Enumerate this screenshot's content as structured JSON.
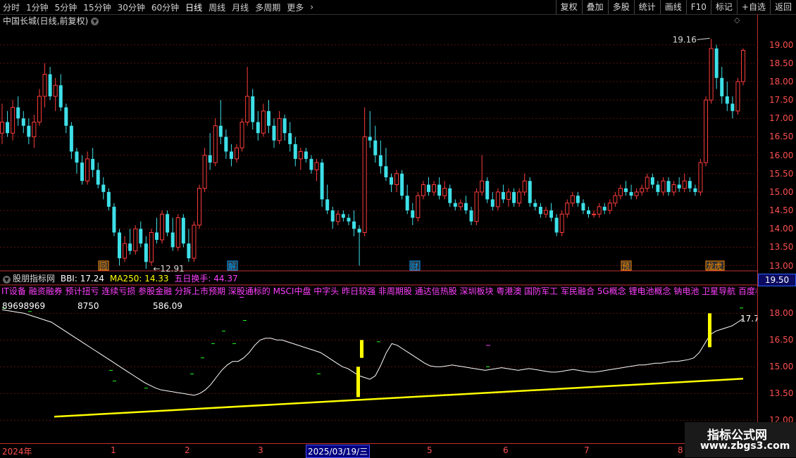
{
  "toolbar": {
    "periods": [
      "分时",
      "1分钟",
      "5分钟",
      "15分钟",
      "30分钟",
      "60分钟",
      "日线",
      "周线",
      "月线",
      "多周期",
      "更多"
    ],
    "active_period": "日线",
    "more_arrow": "›",
    "actions": [
      "复权",
      "叠加",
      "多股",
      "统计",
      "画线",
      "F10",
      "标记",
      "+自选",
      "返回"
    ]
  },
  "stock": {
    "title": "中国长城(日线,前复权)",
    "dropdown_icon": "chevron-down-icon"
  },
  "main_chart": {
    "y_ticks": [
      "19.00",
      "18.50",
      "18.00",
      "17.50",
      "17.00",
      "16.50",
      "16.00",
      "15.50",
      "15.00",
      "14.50",
      "14.00",
      "13.50",
      "13.00"
    ],
    "high_label": "19.16",
    "low_label": "12.91",
    "markers": [
      "回",
      "解",
      "财",
      "预",
      "龙虎"
    ]
  },
  "sub_chart": {
    "indicator_name": "股朋指标网",
    "bbi": "BBI: 17.24",
    "ma250": "MA250: 14.33",
    "turnover": "五日换手: 44.37",
    "concepts": "IT设备 融资融券 预计扭亏 连续亏损 参股金融 分拆上市预期 深股通标的 MSCI中盘 中字头 昨日较强 非周期股 通达信热股 深圳板块 粤港澳 国防军工 军民融合 5G概念 锂电池概念 钠电池 卫星导航 百度概念",
    "num1": "89698969",
    "num2": "8750",
    "num3": "586.09",
    "last_value": "17.7",
    "price_box": "19.50",
    "y_ticks": [
      "18.00",
      "16.50",
      "15.00",
      "13.50",
      "12.00"
    ]
  },
  "x_axis": {
    "labels": [
      "2024年",
      "1",
      "2",
      "3",
      "5",
      "6",
      "7",
      "8"
    ],
    "selected": "2025/03/19/三"
  },
  "watermark": {
    "line1": "指标公式网",
    "line2": "www.zbgs3.com"
  },
  "colors": {
    "up": "#ff3c3c",
    "down": "#3ee0e8",
    "bbi_line": "#ffffff",
    "ma_line": "#ffff00",
    "axis": "#ff5050"
  },
  "chart_data": {
    "type": "candlestick",
    "ylim": [
      12.8,
      19.3
    ],
    "candles": [
      {
        "o": 16.6,
        "h": 17.4,
        "l": 16.3,
        "c": 16.9
      },
      {
        "o": 16.9,
        "h": 17.2,
        "l": 16.5,
        "c": 16.6
      },
      {
        "o": 16.6,
        "h": 17.5,
        "l": 16.4,
        "c": 17.3
      },
      {
        "o": 17.3,
        "h": 17.6,
        "l": 16.8,
        "c": 17.0
      },
      {
        "o": 17.0,
        "h": 17.2,
        "l": 16.6,
        "c": 16.8
      },
      {
        "o": 16.8,
        "h": 17.0,
        "l": 16.3,
        "c": 16.5
      },
      {
        "o": 16.5,
        "h": 17.1,
        "l": 16.2,
        "c": 16.9
      },
      {
        "o": 16.9,
        "h": 17.8,
        "l": 16.8,
        "c": 17.6
      },
      {
        "o": 17.6,
        "h": 18.5,
        "l": 17.3,
        "c": 18.2
      },
      {
        "o": 18.2,
        "h": 18.4,
        "l": 17.5,
        "c": 17.6
      },
      {
        "o": 17.6,
        "h": 18.1,
        "l": 17.2,
        "c": 17.9
      },
      {
        "o": 17.9,
        "h": 18.2,
        "l": 17.2,
        "c": 17.3
      },
      {
        "o": 17.3,
        "h": 17.4,
        "l": 16.6,
        "c": 16.8
      },
      {
        "o": 16.8,
        "h": 16.9,
        "l": 15.9,
        "c": 16.1
      },
      {
        "o": 16.1,
        "h": 16.2,
        "l": 15.5,
        "c": 15.8
      },
      {
        "o": 15.8,
        "h": 16.0,
        "l": 15.2,
        "c": 15.3
      },
      {
        "o": 15.3,
        "h": 16.1,
        "l": 15.2,
        "c": 15.9
      },
      {
        "o": 15.9,
        "h": 16.2,
        "l": 15.4,
        "c": 15.6
      },
      {
        "o": 15.6,
        "h": 15.8,
        "l": 15.1,
        "c": 15.2
      },
      {
        "o": 15.2,
        "h": 15.4,
        "l": 14.8,
        "c": 15.0
      },
      {
        "o": 15.0,
        "h": 15.1,
        "l": 14.5,
        "c": 14.6
      },
      {
        "o": 14.6,
        "h": 14.7,
        "l": 13.8,
        "c": 13.9
      },
      {
        "o": 13.9,
        "h": 14.0,
        "l": 13.0,
        "c": 13.2
      },
      {
        "o": 13.2,
        "h": 13.8,
        "l": 13.1,
        "c": 13.6
      },
      {
        "o": 13.6,
        "h": 14.0,
        "l": 13.3,
        "c": 13.4
      },
      {
        "o": 13.4,
        "h": 14.1,
        "l": 13.3,
        "c": 14.0
      },
      {
        "o": 14.0,
        "h": 14.2,
        "l": 13.5,
        "c": 13.6
      },
      {
        "o": 13.6,
        "h": 13.8,
        "l": 12.91,
        "c": 13.1
      },
      {
        "o": 13.1,
        "h": 14.0,
        "l": 13.0,
        "c": 13.9
      },
      {
        "o": 13.9,
        "h": 14.3,
        "l": 13.6,
        "c": 13.7
      },
      {
        "o": 13.7,
        "h": 14.5,
        "l": 13.6,
        "c": 14.4
      },
      {
        "o": 14.4,
        "h": 14.5,
        "l": 13.8,
        "c": 13.9
      },
      {
        "o": 13.9,
        "h": 14.3,
        "l": 13.4,
        "c": 13.5
      },
      {
        "o": 13.5,
        "h": 14.4,
        "l": 13.4,
        "c": 14.3
      },
      {
        "o": 14.3,
        "h": 14.4,
        "l": 13.5,
        "c": 13.6
      },
      {
        "o": 13.6,
        "h": 14.0,
        "l": 13.1,
        "c": 13.2
      },
      {
        "o": 13.2,
        "h": 14.2,
        "l": 13.1,
        "c": 14.1
      },
      {
        "o": 14.1,
        "h": 15.2,
        "l": 14.0,
        "c": 15.1
      },
      {
        "o": 15.1,
        "h": 16.2,
        "l": 15.0,
        "c": 16.0
      },
      {
        "o": 16.0,
        "h": 16.6,
        "l": 15.6,
        "c": 15.8
      },
      {
        "o": 15.8,
        "h": 17.0,
        "l": 15.7,
        "c": 16.8
      },
      {
        "o": 16.8,
        "h": 17.5,
        "l": 16.3,
        "c": 16.5
      },
      {
        "o": 16.5,
        "h": 16.7,
        "l": 15.9,
        "c": 16.1
      },
      {
        "o": 16.1,
        "h": 16.3,
        "l": 15.7,
        "c": 15.9
      },
      {
        "o": 15.9,
        "h": 16.3,
        "l": 15.8,
        "c": 16.2
      },
      {
        "o": 16.2,
        "h": 17.0,
        "l": 16.1,
        "c": 16.9
      },
      {
        "o": 16.9,
        "h": 18.4,
        "l": 16.8,
        "c": 17.6
      },
      {
        "o": 17.6,
        "h": 17.8,
        "l": 16.7,
        "c": 16.9
      },
      {
        "o": 16.9,
        "h": 17.2,
        "l": 16.4,
        "c": 16.6
      },
      {
        "o": 16.6,
        "h": 17.4,
        "l": 16.5,
        "c": 17.2
      },
      {
        "o": 17.2,
        "h": 17.5,
        "l": 16.6,
        "c": 16.8
      },
      {
        "o": 16.8,
        "h": 17.0,
        "l": 16.2,
        "c": 16.4
      },
      {
        "o": 16.4,
        "h": 17.2,
        "l": 16.3,
        "c": 17.0
      },
      {
        "o": 17.0,
        "h": 17.1,
        "l": 16.4,
        "c": 16.6
      },
      {
        "o": 16.6,
        "h": 16.9,
        "l": 16.1,
        "c": 16.3
      },
      {
        "o": 16.3,
        "h": 16.5,
        "l": 15.7,
        "c": 15.9
      },
      {
        "o": 15.9,
        "h": 16.2,
        "l": 15.6,
        "c": 16.1
      },
      {
        "o": 16.1,
        "h": 16.2,
        "l": 15.8,
        "c": 15.9
      },
      {
        "o": 15.9,
        "h": 16.0,
        "l": 15.5,
        "c": 15.6
      },
      {
        "o": 15.6,
        "h": 15.9,
        "l": 15.3,
        "c": 15.8
      },
      {
        "o": 15.8,
        "h": 15.9,
        "l": 14.6,
        "c": 14.8
      },
      {
        "o": 14.8,
        "h": 15.2,
        "l": 14.4,
        "c": 14.5
      },
      {
        "o": 14.5,
        "h": 14.6,
        "l": 14.0,
        "c": 14.2
      },
      {
        "o": 14.2,
        "h": 14.5,
        "l": 14.1,
        "c": 14.4
      },
      {
        "o": 14.4,
        "h": 14.5,
        "l": 14.2,
        "c": 14.3
      },
      {
        "o": 14.3,
        "h": 14.4,
        "l": 14.1,
        "c": 14.2
      },
      {
        "o": 14.2,
        "h": 14.5,
        "l": 13.8,
        "c": 14.0
      },
      {
        "o": 14.0,
        "h": 14.1,
        "l": 13.0,
        "c": 13.9
      },
      {
        "o": 13.9,
        "h": 17.3,
        "l": 13.8,
        "c": 16.5
      },
      {
        "o": 16.5,
        "h": 17.2,
        "l": 16.2,
        "c": 16.4
      },
      {
        "o": 16.4,
        "h": 16.8,
        "l": 15.8,
        "c": 16.0
      },
      {
        "o": 16.0,
        "h": 16.4,
        "l": 15.5,
        "c": 15.7
      },
      {
        "o": 15.7,
        "h": 16.2,
        "l": 15.3,
        "c": 15.4
      },
      {
        "o": 15.4,
        "h": 15.5,
        "l": 15.0,
        "c": 15.2
      },
      {
        "o": 15.2,
        "h": 15.6,
        "l": 15.0,
        "c": 15.5
      },
      {
        "o": 15.5,
        "h": 15.6,
        "l": 14.8,
        "c": 14.9
      },
      {
        "o": 14.9,
        "h": 15.2,
        "l": 14.4,
        "c": 14.5
      },
      {
        "o": 14.5,
        "h": 14.7,
        "l": 14.1,
        "c": 14.3
      },
      {
        "o": 14.3,
        "h": 15.0,
        "l": 14.2,
        "c": 14.9
      },
      {
        "o": 14.9,
        "h": 15.3,
        "l": 14.8,
        "c": 15.2
      },
      {
        "o": 15.2,
        "h": 15.4,
        "l": 14.9,
        "c": 15.0
      },
      {
        "o": 15.0,
        "h": 15.3,
        "l": 14.9,
        "c": 15.2
      },
      {
        "o": 15.2,
        "h": 15.4,
        "l": 14.8,
        "c": 14.9
      },
      {
        "o": 14.9,
        "h": 15.3,
        "l": 14.8,
        "c": 15.1
      },
      {
        "o": 15.1,
        "h": 15.2,
        "l": 14.6,
        "c": 14.7
      },
      {
        "o": 14.7,
        "h": 14.8,
        "l": 14.5,
        "c": 14.6
      },
      {
        "o": 14.6,
        "h": 14.8,
        "l": 14.5,
        "c": 14.7
      },
      {
        "o": 14.7,
        "h": 14.9,
        "l": 14.4,
        "c": 14.5
      },
      {
        "o": 14.5,
        "h": 14.6,
        "l": 14.1,
        "c": 14.2
      },
      {
        "o": 14.2,
        "h": 15.1,
        "l": 14.1,
        "c": 15.0
      },
      {
        "o": 15.0,
        "h": 16.0,
        "l": 14.9,
        "c": 15.3
      },
      {
        "o": 15.3,
        "h": 15.4,
        "l": 14.7,
        "c": 14.8
      },
      {
        "o": 14.8,
        "h": 15.0,
        "l": 14.5,
        "c": 14.6
      },
      {
        "o": 14.6,
        "h": 15.1,
        "l": 14.5,
        "c": 15.0
      },
      {
        "o": 15.0,
        "h": 15.2,
        "l": 14.7,
        "c": 14.8
      },
      {
        "o": 14.8,
        "h": 15.1,
        "l": 14.6,
        "c": 15.0
      },
      {
        "o": 15.0,
        "h": 15.1,
        "l": 14.6,
        "c": 14.7
      },
      {
        "o": 14.7,
        "h": 15.1,
        "l": 14.6,
        "c": 15.0
      },
      {
        "o": 15.0,
        "h": 15.5,
        "l": 14.9,
        "c": 15.3
      },
      {
        "o": 15.3,
        "h": 15.4,
        "l": 14.6,
        "c": 14.7
      },
      {
        "o": 14.7,
        "h": 14.8,
        "l": 14.5,
        "c": 14.6
      },
      {
        "o": 14.6,
        "h": 14.7,
        "l": 14.3,
        "c": 14.4
      },
      {
        "o": 14.4,
        "h": 14.6,
        "l": 14.3,
        "c": 14.5
      },
      {
        "o": 14.5,
        "h": 14.7,
        "l": 14.2,
        "c": 14.3
      },
      {
        "o": 14.3,
        "h": 14.4,
        "l": 13.8,
        "c": 13.9
      },
      {
        "o": 13.9,
        "h": 14.5,
        "l": 13.8,
        "c": 14.4
      },
      {
        "o": 14.4,
        "h": 14.8,
        "l": 14.3,
        "c": 14.7
      },
      {
        "o": 14.7,
        "h": 15.0,
        "l": 14.6,
        "c": 14.9
      },
      {
        "o": 14.9,
        "h": 15.0,
        "l": 14.6,
        "c": 14.7
      },
      {
        "o": 14.7,
        "h": 14.8,
        "l": 14.4,
        "c": 14.5
      },
      {
        "o": 14.5,
        "h": 14.6,
        "l": 14.3,
        "c": 14.4
      },
      {
        "o": 14.4,
        "h": 14.5,
        "l": 14.3,
        "c": 14.4
      },
      {
        "o": 14.4,
        "h": 14.7,
        "l": 14.3,
        "c": 14.6
      },
      {
        "o": 14.6,
        "h": 14.7,
        "l": 14.4,
        "c": 14.5
      },
      {
        "o": 14.5,
        "h": 14.8,
        "l": 14.4,
        "c": 14.7
      },
      {
        "o": 14.7,
        "h": 15.0,
        "l": 14.6,
        "c": 14.9
      },
      {
        "o": 14.9,
        "h": 15.2,
        "l": 14.8,
        "c": 15.1
      },
      {
        "o": 15.1,
        "h": 15.3,
        "l": 14.9,
        "c": 15.0
      },
      {
        "o": 15.0,
        "h": 15.2,
        "l": 14.8,
        "c": 14.9
      },
      {
        "o": 14.9,
        "h": 15.1,
        "l": 14.8,
        "c": 15.0
      },
      {
        "o": 15.0,
        "h": 15.2,
        "l": 14.9,
        "c": 15.1
      },
      {
        "o": 15.1,
        "h": 15.5,
        "l": 15.0,
        "c": 15.4
      },
      {
        "o": 15.4,
        "h": 15.5,
        "l": 15.1,
        "c": 15.2
      },
      {
        "o": 15.2,
        "h": 15.3,
        "l": 14.9,
        "c": 15.0
      },
      {
        "o": 15.0,
        "h": 15.4,
        "l": 14.9,
        "c": 15.3
      },
      {
        "o": 15.3,
        "h": 15.4,
        "l": 14.9,
        "c": 15.0
      },
      {
        "o": 15.0,
        "h": 15.3,
        "l": 14.9,
        "c": 15.2
      },
      {
        "o": 15.2,
        "h": 15.4,
        "l": 15.0,
        "c": 15.1
      },
      {
        "o": 15.1,
        "h": 15.5,
        "l": 15.0,
        "c": 15.3
      },
      {
        "o": 15.3,
        "h": 15.4,
        "l": 15.0,
        "c": 15.1
      },
      {
        "o": 15.1,
        "h": 15.2,
        "l": 14.9,
        "c": 15.0
      },
      {
        "o": 15.0,
        "h": 15.9,
        "l": 14.9,
        "c": 15.8
      },
      {
        "o": 15.8,
        "h": 17.6,
        "l": 15.7,
        "c": 17.5
      },
      {
        "o": 17.5,
        "h": 19.16,
        "l": 17.4,
        "c": 18.9
      },
      {
        "o": 18.9,
        "h": 19.0,
        "l": 17.8,
        "c": 18.1
      },
      {
        "o": 18.1,
        "h": 18.4,
        "l": 17.4,
        "c": 17.6
      },
      {
        "o": 17.6,
        "h": 18.0,
        "l": 17.2,
        "c": 17.4
      },
      {
        "o": 17.4,
        "h": 17.6,
        "l": 17.0,
        "c": 17.2
      },
      {
        "o": 17.2,
        "h": 18.1,
        "l": 17.1,
        "c": 18.0
      },
      {
        "o": 18.0,
        "h": 18.9,
        "l": 17.9,
        "c": 18.85
      }
    ],
    "bbi_values": [
      18.2,
      18.15,
      18.1,
      18.05,
      18.0,
      17.9,
      17.8,
      17.7,
      17.6,
      17.5,
      17.3,
      17.1,
      16.9,
      16.7,
      16.5,
      16.3,
      16.1,
      15.9,
      15.7,
      15.5,
      15.3,
      15.1,
      14.9,
      14.7,
      14.5,
      14.3,
      14.1,
      13.95,
      13.8,
      13.7,
      13.65,
      13.6,
      13.55,
      13.5,
      13.45,
      13.4,
      13.5,
      13.7,
      14.0,
      14.4,
      14.8,
      15.1,
      15.3,
      15.3,
      15.5,
      15.8,
      16.2,
      16.5,
      16.6,
      16.6,
      16.5,
      16.5,
      16.4,
      16.3,
      16.2,
      16.1,
      16.0,
      15.9,
      15.8,
      15.6,
      15.4,
      15.2,
      15.0,
      14.9,
      14.7,
      14.5,
      14.4,
      14.3,
      14.5,
      15.1,
      15.8,
      16.3,
      16.2,
      16.0,
      15.8,
      15.6,
      15.4,
      15.2,
      15.05,
      15.0,
      15.0,
      15.05,
      15.1,
      15.05,
      15.0,
      14.95,
      14.9,
      14.85,
      14.8,
      14.85,
      14.9,
      14.95,
      14.9,
      14.85,
      14.8,
      14.85,
      14.9,
      14.85,
      14.8,
      14.75,
      14.7,
      14.7,
      14.75,
      14.8,
      14.85,
      14.8,
      14.75,
      14.7,
      14.7,
      14.75,
      14.8,
      14.85,
      14.9,
      14.95,
      15.0,
      15.05,
      15.1,
      15.1,
      15.15,
      15.2,
      15.2,
      15.25,
      15.3,
      15.3,
      15.35,
      15.4,
      15.5,
      15.8,
      16.3,
      16.8,
      17.0,
      17.1,
      17.2,
      17.3,
      17.5,
      17.7
    ],
    "ma250_start": 12.2,
    "ma250_end": 14.33
  }
}
